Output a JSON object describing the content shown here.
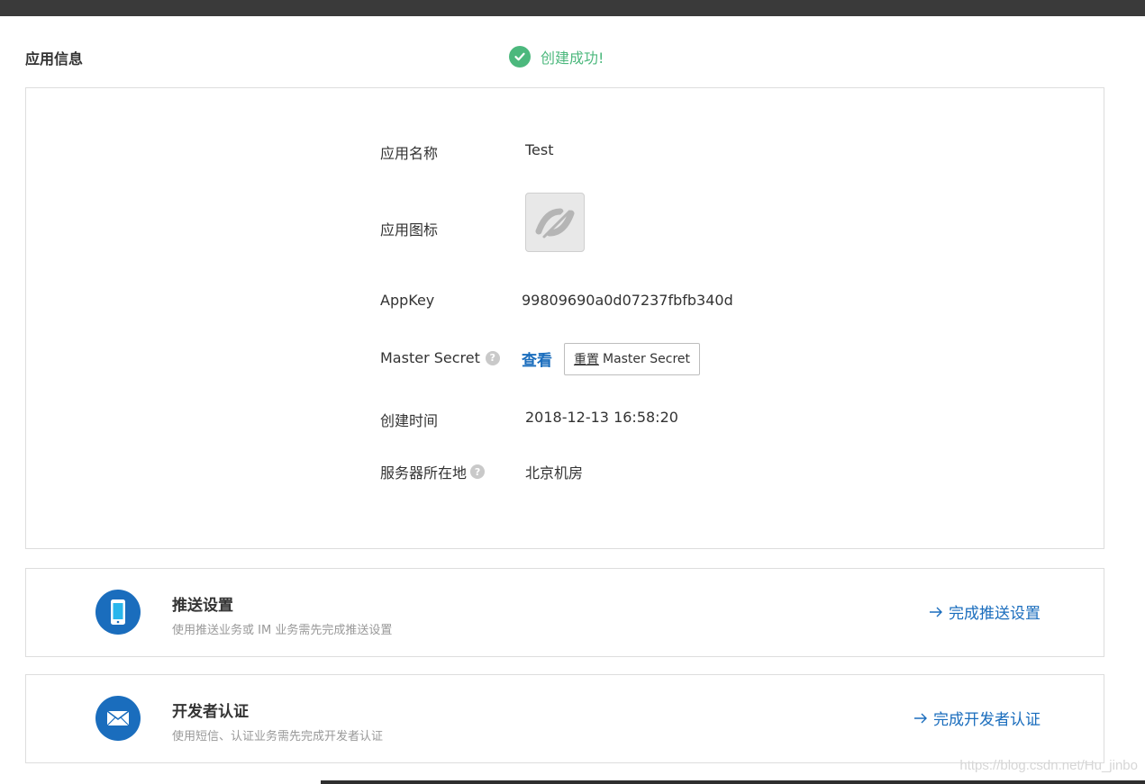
{
  "header": {
    "section_title": "应用信息",
    "success_message": "创建成功!"
  },
  "app_info": {
    "name_label": "应用名称",
    "name_value": "Test",
    "icon_label": "应用图标",
    "appkey_label": "AppKey",
    "appkey_value": "99809690a0d07237fbfb340d",
    "master_secret_label": "Master Secret",
    "view_link": "查看",
    "reset_prefix": "重置",
    "reset_suffix": "Master Secret",
    "created_label": "创建时间",
    "created_value": "2018-12-13 16:58:20",
    "server_label": "服务器所在地",
    "server_value": "北京机房",
    "help_glyph": "?"
  },
  "cards": [
    {
      "title": "推送设置",
      "desc": "使用推送业务或 IM 业务需先完成推送设置",
      "link": "完成推送设置",
      "icon": "phone-icon"
    },
    {
      "title": "开发者认证",
      "desc": "使用短信、认证业务需先完成开发者认证",
      "link": "完成开发者认证",
      "icon": "envelope-icon"
    }
  ],
  "watermark": "https://blog.csdn.net/Hu_jinbo",
  "colors": {
    "success": "#4cb87d",
    "link": "#1a6dbd",
    "accent_circle": "#1a6dbd",
    "border": "#dddddd",
    "topbar": "#3a3a3a"
  }
}
